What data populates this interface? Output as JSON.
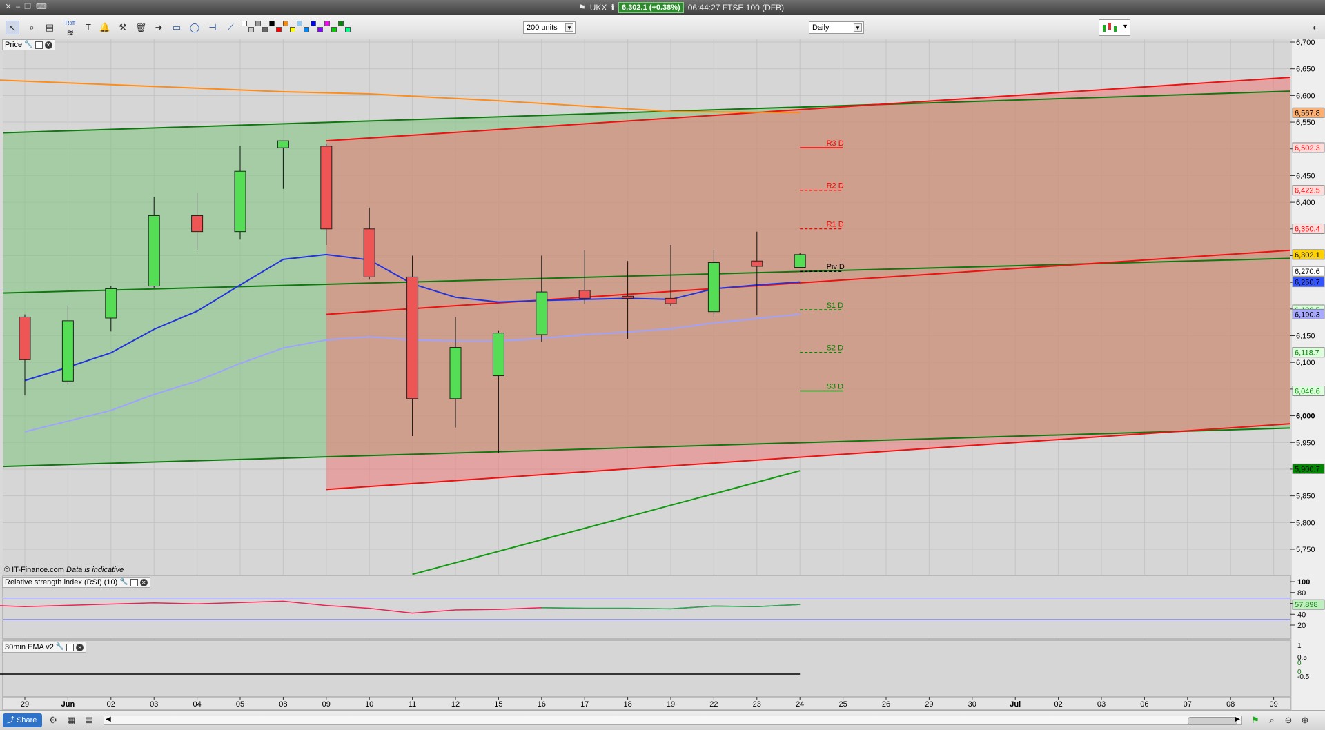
{
  "titlebar": {
    "instrument": "UKX",
    "quote": "6,302.1 (+0.38%)",
    "time_and_market": "06:44:27 FTSE 100 (DFB)"
  },
  "toolbar": {
    "units_select": "200 units",
    "interval_select": "Daily",
    "tool_icons": [
      "pointer-icon",
      "zoom-icon",
      "fibonacci-icon",
      "text-icon",
      "raff-channel-icon",
      "alert-bell-icon",
      "hammer-icon",
      "trash-icon",
      "arrow-icon",
      "rectangle-icon",
      "lasso-icon",
      "horizontal-line-icon",
      "trend-line-icon"
    ],
    "swatch_colors": [
      "#ffffff",
      "#cccccc",
      "#999999",
      "#666666",
      "#000000",
      "#ff0000",
      "#ff8800",
      "#ffff00",
      "#88ccff",
      "#0088ff",
      "#0000ff",
      "#8800ff",
      "#ff00ff",
      "#00cc00",
      "#008800",
      "#00ff88"
    ],
    "raff_label": "Raff"
  },
  "panels": {
    "price_label": "Price",
    "rsi_label": "Relative strength index (RSI) (10)",
    "ema_label": "30min EMA v2",
    "copyright": "© IT-Finance.com",
    "indicative": "Data is indicative"
  },
  "statusbar": {
    "share_label": "Share"
  },
  "chart_data": [
    {
      "type": "candlestick",
      "panel": "price",
      "ylim": [
        5700,
        6700
      ],
      "y_ticks": [
        "6,700",
        "6,650",
        "6,600",
        "6,550",
        "6,500",
        "6,450",
        "6,400",
        "6,350",
        "6,300",
        "6,250",
        "6,200",
        "6,150",
        "6,100",
        "6,050",
        "6,000",
        "5,950",
        "5,900",
        "5,850",
        "5,800",
        "5,750"
      ],
      "x_ticks": [
        "29",
        "Jun",
        "02",
        "03",
        "04",
        "05",
        "08",
        "09",
        "10",
        "11",
        "12",
        "15",
        "16",
        "17",
        "18",
        "19",
        "22",
        "23",
        "24",
        "25",
        "26",
        "29",
        "30",
        "Jul",
        "02",
        "03",
        "06",
        "07",
        "08",
        "09"
      ],
      "candles": [
        {
          "x": "29",
          "open": 6185,
          "high": 6190,
          "low": 6038,
          "close": 6105
        },
        {
          "x": "Jun",
          "open": 6065,
          "high": 6205,
          "low": 6058,
          "close": 6178
        },
        {
          "x": "02",
          "open": 6183,
          "high": 6243,
          "low": 6158,
          "close": 6238
        },
        {
          "x": "03",
          "open": 6243,
          "high": 6410,
          "low": 6240,
          "close": 6375
        },
        {
          "x": "04",
          "open": 6375,
          "high": 6417,
          "low": 6310,
          "close": 6345
        },
        {
          "x": "05",
          "open": 6345,
          "high": 6505,
          "low": 6330,
          "close": 6458
        },
        {
          "x": "08",
          "open": 6502,
          "high": 6515,
          "low": 6425,
          "close": 6515
        },
        {
          "x": "09",
          "open": 6505,
          "high": 6510,
          "low": 6320,
          "close": 6350
        },
        {
          "x": "10",
          "open": 6350,
          "high": 6390,
          "low": 6255,
          "close": 6260
        },
        {
          "x": "11",
          "open": 6260,
          "high": 6300,
          "low": 5962,
          "close": 6032
        },
        {
          "x": "12",
          "open": 6032,
          "high": 6185,
          "low": 5978,
          "close": 6128
        },
        {
          "x": "15",
          "open": 6075,
          "high": 6160,
          "low": 5930,
          "close": 6155
        },
        {
          "x": "16",
          "open": 6152,
          "high": 6300,
          "low": 6138,
          "close": 6232
        },
        {
          "x": "17",
          "open": 6235,
          "high": 6310,
          "low": 6210,
          "close": 6220
        },
        {
          "x": "18",
          "open": 6224,
          "high": 6290,
          "low": 6143,
          "close": 6220
        },
        {
          "x": "19",
          "open": 6220,
          "high": 6320,
          "low": 6205,
          "close": 6210
        },
        {
          "x": "22",
          "open": 6195,
          "high": 6310,
          "low": 6185,
          "close": 6287
        },
        {
          "x": "23",
          "open": 6290,
          "high": 6345,
          "low": 6188,
          "close": 6280
        },
        {
          "x": "24",
          "open": 6278,
          "high": 6305,
          "low": 6278,
          "close": 6302.1
        }
      ],
      "pivot_levels": [
        {
          "label": "R3 D",
          "value": 6502.3,
          "value_label": "6,502.3",
          "color": "#ff0000",
          "style": "solid"
        },
        {
          "label": "R2 D",
          "value": 6422.5,
          "value_label": "6,422.5",
          "color": "#ff0000",
          "style": "dashed"
        },
        {
          "label": "R1 D",
          "value": 6350.4,
          "value_label": "6,350.4",
          "color": "#ff0000",
          "style": "dashed"
        },
        {
          "label": "Piv D",
          "value": 6270.6,
          "value_label": "6,270.6",
          "color": "#000000",
          "style": "dashed"
        },
        {
          "label": "S1 D",
          "value": 6198.5,
          "value_label": "6,198.5",
          "color": "#008800",
          "style": "dashed"
        },
        {
          "label": "S2 D",
          "value": 6118.7,
          "value_label": "6,118.7",
          "color": "#008800",
          "style": "dashed"
        },
        {
          "label": "S3 D",
          "value": 6046.6,
          "value_label": "6,046.6",
          "color": "#008800",
          "style": "solid"
        }
      ],
      "price_markers": [
        {
          "value": 6567.8,
          "label": "6,567.8",
          "color": "#ffb070"
        },
        {
          "value": 6302.1,
          "label": "6,302.1",
          "color": "#ffd200"
        },
        {
          "value": 6250.7,
          "label": "6,250.7",
          "color": "#3355ff"
        },
        {
          "value": 6190.3,
          "label": "6,190.3",
          "color": "#a8aaff"
        },
        {
          "value": 5900.7,
          "label": "5,900.7",
          "color": "#008800"
        }
      ],
      "moving_averages": [
        {
          "color": "#2233dd",
          "points": [
            [
              "29",
              6066
            ],
            [
              "Jun",
              6091
            ],
            [
              "02",
              6118
            ],
            [
              "03",
              6162
            ],
            [
              "04",
              6196
            ],
            [
              "05",
              6245
            ],
            [
              "08",
              6293
            ],
            [
              "09",
              6302
            ],
            [
              "10",
              6292
            ],
            [
              "11",
              6247
            ],
            [
              "12",
              6222
            ],
            [
              "15",
              6213
            ],
            [
              "16",
              6216
            ],
            [
              "17",
              6218
            ],
            [
              "18",
              6220
            ],
            [
              "19",
              6218
            ],
            [
              "22",
              6238
            ],
            [
              "23",
              6245
            ],
            [
              "24",
              6250.7
            ]
          ]
        },
        {
          "color": "#9fa3ff",
          "points": [
            [
              "29",
              5970
            ],
            [
              "Jun",
              5990
            ],
            [
              "02",
              6010
            ],
            [
              "03",
              6040
            ],
            [
              "04",
              6065
            ],
            [
              "05",
              6098
            ],
            [
              "08",
              6127
            ],
            [
              "09",
              6142
            ],
            [
              "10",
              6148
            ],
            [
              "11",
              6142
            ],
            [
              "12",
              6140
            ],
            [
              "15",
              6140
            ],
            [
              "16",
              6145
            ],
            [
              "17",
              6152
            ],
            [
              "18",
              6157
            ],
            [
              "19",
              6163
            ],
            [
              "22",
              6174
            ],
            [
              "23",
              6182
            ],
            [
              "24",
              6190.3
            ]
          ]
        },
        {
          "color": "#ff8c1a",
          "points": [
            [
              "28",
              6630
            ],
            [
              "03",
              6617
            ],
            [
              "08",
              6607
            ],
            [
              "10",
              6603
            ],
            [
              "15",
              6590
            ],
            [
              "19",
              6570
            ],
            [
              "24",
              6567.8
            ]
          ]
        }
      ]
    },
    {
      "type": "line",
      "panel": "rsi",
      "title": "Relative strength index (RSI) (10)",
      "ylim": [
        0,
        100
      ],
      "y_ticks": [
        "100",
        "80",
        "60",
        "40",
        "20"
      ],
      "current_value": "57.898",
      "series": [
        {
          "color": "#ee2255",
          "values": [
            [
              "28",
              57
            ],
            [
              "29",
              54
            ],
            [
              "03",
              61
            ],
            [
              "04",
              59
            ],
            [
              "08",
              64
            ],
            [
              "09",
              56
            ],
            [
              "10",
              51
            ],
            [
              "11",
              42
            ],
            [
              "12",
              48
            ],
            [
              "15",
              49
            ],
            [
              "16",
              52
            ],
            [
              "17",
              51
            ],
            [
              "18",
              51
            ],
            [
              "19",
              50
            ],
            [
              "22",
              55
            ],
            [
              "23",
              54
            ],
            [
              "24",
              57.898
            ]
          ]
        }
      ]
    },
    {
      "type": "line",
      "panel": "ema",
      "title": "30min EMA v2",
      "ylim": [
        -0.5,
        1
      ],
      "y_ticks": [
        "1",
        "0.5",
        "0",
        "0",
        "-0.5"
      ],
      "series": [
        {
          "color": "#000000",
          "values": [
            [
              "28",
              0
            ],
            [
              "24",
              0
            ]
          ]
        }
      ]
    }
  ]
}
